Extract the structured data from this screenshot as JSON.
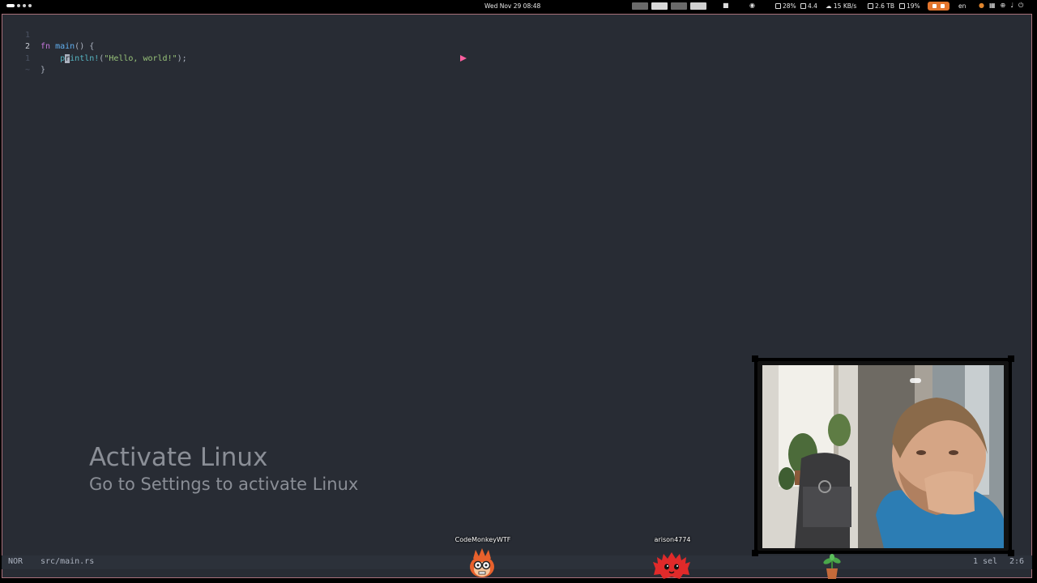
{
  "topbar": {
    "datetime": "Wed Nov 29  08:48",
    "stats": {
      "cpu": "28%",
      "load": "4.4",
      "network": "15 KB/s",
      "disk": "2.6 TB",
      "battery": "19%"
    },
    "language": "en",
    "accent_color": "#e3752d"
  },
  "editor": {
    "lines": [
      {
        "number": "1",
        "relative": true
      },
      {
        "number": "2",
        "relative": false
      },
      {
        "number": "1",
        "relative": true
      }
    ],
    "code": {
      "l1_kw": "fn",
      "l1_fn": "main",
      "l1_rest": "() {",
      "l2_indent": "    ",
      "l2_cursor_char": "p",
      "l2_after_cursor_char": "r",
      "l2_macro": "intln!",
      "l2_open": "(",
      "l2_string": "\"Hello, world!\"",
      "l2_close": ");",
      "l3_text": "}",
      "tilde": "~"
    },
    "colors": {
      "background": "#282c34",
      "keyword": "#c678dd",
      "function": "#61afef",
      "string": "#98c379"
    }
  },
  "watermark": {
    "title": "Activate Linux",
    "subtitle": "Go to Settings to activate Linux"
  },
  "statusline": {
    "mode": "NOR",
    "file": "src/main.rs",
    "selections": "1 sel",
    "position": "2:6"
  },
  "chat": {
    "user1": "CodeMonkeyWTF",
    "user2": "arison4774"
  }
}
